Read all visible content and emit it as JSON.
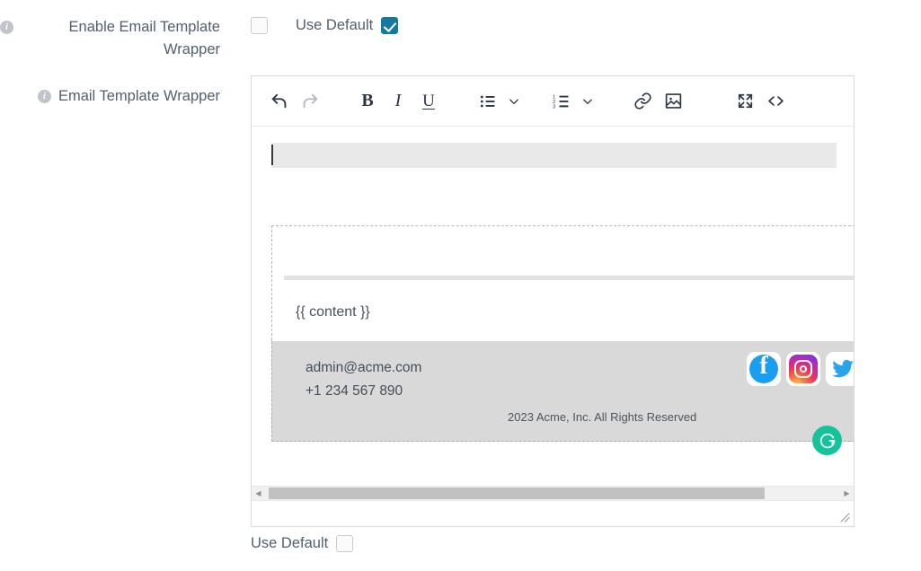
{
  "form": {
    "rows": [
      {
        "label": "Enable Email Template Wrapper",
        "info_icon": "info-icon",
        "value_checkbox_checked": false,
        "use_default_label": "Use Default",
        "use_default_checked": true
      },
      {
        "label": "Email Template Wrapper",
        "info_icon": "info-icon",
        "use_default_label": "Use Default",
        "use_default_checked": false
      }
    ]
  },
  "editor": {
    "toolbar": {
      "buttons": [
        {
          "name": "undo-icon",
          "title": "Undo",
          "disabled": false
        },
        {
          "name": "redo-icon",
          "title": "Redo",
          "disabled": true
        },
        {
          "name": "bold-icon",
          "title": "Bold",
          "glyph": "B"
        },
        {
          "name": "italic-icon",
          "title": "Italic",
          "glyph": "I"
        },
        {
          "name": "underline-icon",
          "title": "Underline",
          "glyph": "U"
        },
        {
          "name": "bullet-list-icon",
          "title": "Bulleted list",
          "disabled": false
        },
        {
          "name": "chevron-down-icon",
          "title": "Bulleted list options"
        },
        {
          "name": "numbered-list-icon",
          "title": "Numbered list",
          "disabled": false
        },
        {
          "name": "chevron-down-icon",
          "title": "Numbered list options"
        },
        {
          "name": "link-icon",
          "title": "Insert link"
        },
        {
          "name": "image-icon",
          "title": "Insert image"
        },
        {
          "name": "fullscreen-icon",
          "title": "Fullscreen"
        },
        {
          "name": "code-view-icon",
          "title": "Source code"
        }
      ]
    },
    "content": {
      "body_token": "{{ content }}",
      "footer": {
        "email": "admin@acme.com",
        "phone": "+1 234 567 890",
        "copyright": "2023 Acme, Inc. All Rights Reserved",
        "social": [
          {
            "name": "facebook-icon",
            "label": "Facebook"
          },
          {
            "name": "instagram-icon",
            "label": "Instagram"
          },
          {
            "name": "twitter-icon",
            "label": "Twitter"
          }
        ]
      }
    },
    "scrollbar": {
      "name": "horizontal-scrollbar",
      "thumb_fraction": 0.84
    },
    "grammarly_badge": {
      "name": "grammarly-badge",
      "glyph": "G"
    },
    "resize_handle": {
      "name": "resize-handle"
    }
  },
  "colors": {
    "accent_checkbox": "#1379a0",
    "label_text": "#51606e",
    "toolbar_icon": "#2b3648",
    "toolbar_icon_disabled": "#b3b9c2",
    "editor_border": "#d6dade",
    "mail_header_bg": "#e9e9e9",
    "mail_footer_bg": "#d9d9d9",
    "grammarly_green": "#15c39a"
  }
}
